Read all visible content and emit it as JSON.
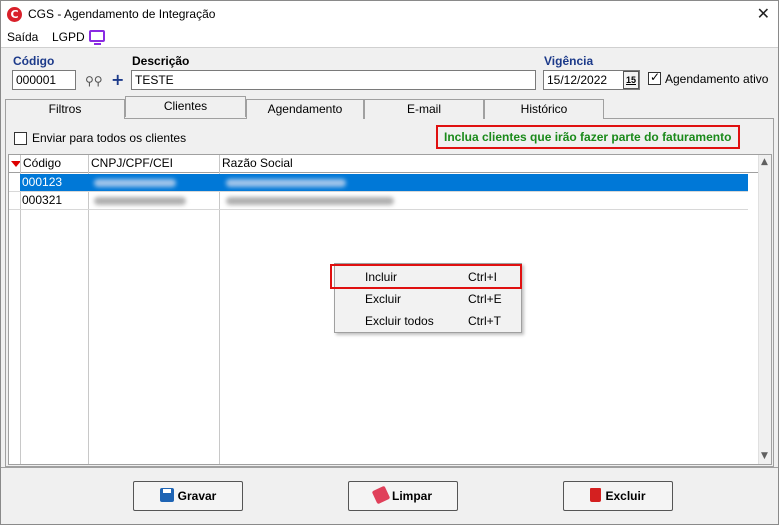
{
  "window": {
    "title": "CGS - Agendamento de Integração",
    "app_icon_letter": "C",
    "close_glyph": "✕"
  },
  "menu": {
    "items": [
      "Saída",
      "LGPD"
    ],
    "lgpd_icon": "monitor-icon"
  },
  "form": {
    "codigo_label": "Código",
    "codigo_value": "000001",
    "descricao_label": "Descrição",
    "descricao_value": "TESTE",
    "vigencia_label": "Vigência",
    "vigencia_value": "15/12/2022",
    "calendar_label": "15",
    "agendamento_ativo_label": "Agendamento ativo",
    "agendamento_ativo_checked": true
  },
  "tabs": [
    {
      "label": "Filtros",
      "active": false
    },
    {
      "label": "Clientes",
      "active": true
    },
    {
      "label": "Agendamento",
      "active": false
    },
    {
      "label": "E-mail",
      "active": false
    },
    {
      "label": "Histórico",
      "active": false
    }
  ],
  "clientes": {
    "enviar_todos_label": "Enviar para todos os clientes",
    "enviar_todos_checked": false,
    "hint_text": "Inclua clientes que irão fazer parte do faturamento",
    "columns": [
      "Código",
      "CNPJ/CPF/CEI",
      "Razão Social"
    ],
    "rows": [
      {
        "codigo": "000123",
        "selected": true
      },
      {
        "codigo": "000321",
        "selected": false
      }
    ]
  },
  "context_menu": {
    "items": [
      {
        "label": "Incluir",
        "shortcut": "Ctrl+I"
      },
      {
        "label": "Excluir",
        "shortcut": "Ctrl+E"
      },
      {
        "label": "Excluir todos",
        "shortcut": "Ctrl+T"
      }
    ]
  },
  "buttons": {
    "gravar": "Gravar",
    "limpar": "Limpar",
    "excluir": "Excluir"
  },
  "colors": {
    "selection": "#0078d7",
    "hint_text": "#1a8a1a",
    "highlight_border": "#e01010",
    "label_blue": "#1c3a8a"
  }
}
